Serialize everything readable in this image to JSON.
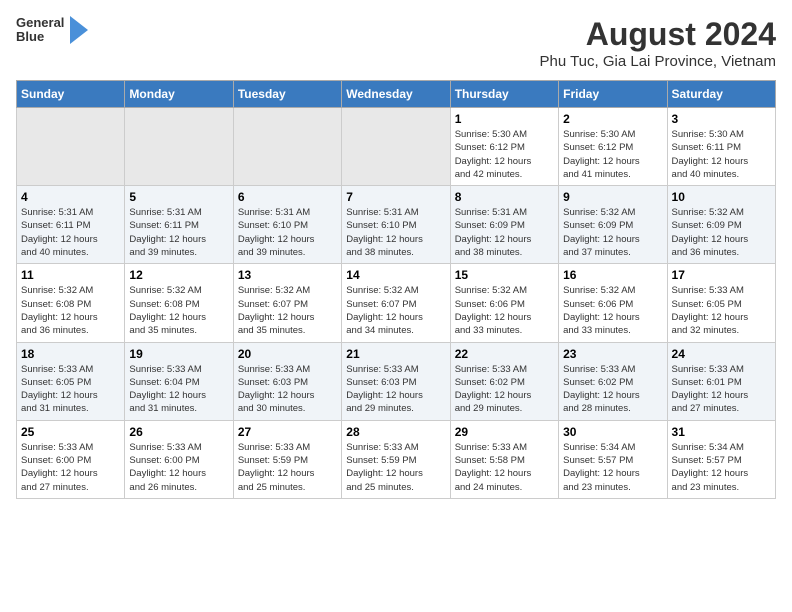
{
  "header": {
    "logo_line1": "General",
    "logo_line2": "Blue",
    "title": "August 2024",
    "subtitle": "Phu Tuc, Gia Lai Province, Vietnam"
  },
  "days_of_week": [
    "Sunday",
    "Monday",
    "Tuesday",
    "Wednesday",
    "Thursday",
    "Friday",
    "Saturday"
  ],
  "weeks": [
    {
      "days": [
        {
          "num": "",
          "info": "",
          "empty": true
        },
        {
          "num": "",
          "info": "",
          "empty": true
        },
        {
          "num": "",
          "info": "",
          "empty": true
        },
        {
          "num": "",
          "info": "",
          "empty": true
        },
        {
          "num": "1",
          "info": "Sunrise: 5:30 AM\nSunset: 6:12 PM\nDaylight: 12 hours\nand 42 minutes.",
          "empty": false
        },
        {
          "num": "2",
          "info": "Sunrise: 5:30 AM\nSunset: 6:12 PM\nDaylight: 12 hours\nand 41 minutes.",
          "empty": false
        },
        {
          "num": "3",
          "info": "Sunrise: 5:30 AM\nSunset: 6:11 PM\nDaylight: 12 hours\nand 40 minutes.",
          "empty": false
        }
      ]
    },
    {
      "days": [
        {
          "num": "4",
          "info": "Sunrise: 5:31 AM\nSunset: 6:11 PM\nDaylight: 12 hours\nand 40 minutes.",
          "empty": false
        },
        {
          "num": "5",
          "info": "Sunrise: 5:31 AM\nSunset: 6:11 PM\nDaylight: 12 hours\nand 39 minutes.",
          "empty": false
        },
        {
          "num": "6",
          "info": "Sunrise: 5:31 AM\nSunset: 6:10 PM\nDaylight: 12 hours\nand 39 minutes.",
          "empty": false
        },
        {
          "num": "7",
          "info": "Sunrise: 5:31 AM\nSunset: 6:10 PM\nDaylight: 12 hours\nand 38 minutes.",
          "empty": false
        },
        {
          "num": "8",
          "info": "Sunrise: 5:31 AM\nSunset: 6:09 PM\nDaylight: 12 hours\nand 38 minutes.",
          "empty": false
        },
        {
          "num": "9",
          "info": "Sunrise: 5:32 AM\nSunset: 6:09 PM\nDaylight: 12 hours\nand 37 minutes.",
          "empty": false
        },
        {
          "num": "10",
          "info": "Sunrise: 5:32 AM\nSunset: 6:09 PM\nDaylight: 12 hours\nand 36 minutes.",
          "empty": false
        }
      ]
    },
    {
      "days": [
        {
          "num": "11",
          "info": "Sunrise: 5:32 AM\nSunset: 6:08 PM\nDaylight: 12 hours\nand 36 minutes.",
          "empty": false
        },
        {
          "num": "12",
          "info": "Sunrise: 5:32 AM\nSunset: 6:08 PM\nDaylight: 12 hours\nand 35 minutes.",
          "empty": false
        },
        {
          "num": "13",
          "info": "Sunrise: 5:32 AM\nSunset: 6:07 PM\nDaylight: 12 hours\nand 35 minutes.",
          "empty": false
        },
        {
          "num": "14",
          "info": "Sunrise: 5:32 AM\nSunset: 6:07 PM\nDaylight: 12 hours\nand 34 minutes.",
          "empty": false
        },
        {
          "num": "15",
          "info": "Sunrise: 5:32 AM\nSunset: 6:06 PM\nDaylight: 12 hours\nand 33 minutes.",
          "empty": false
        },
        {
          "num": "16",
          "info": "Sunrise: 5:32 AM\nSunset: 6:06 PM\nDaylight: 12 hours\nand 33 minutes.",
          "empty": false
        },
        {
          "num": "17",
          "info": "Sunrise: 5:33 AM\nSunset: 6:05 PM\nDaylight: 12 hours\nand 32 minutes.",
          "empty": false
        }
      ]
    },
    {
      "days": [
        {
          "num": "18",
          "info": "Sunrise: 5:33 AM\nSunset: 6:05 PM\nDaylight: 12 hours\nand 31 minutes.",
          "empty": false
        },
        {
          "num": "19",
          "info": "Sunrise: 5:33 AM\nSunset: 6:04 PM\nDaylight: 12 hours\nand 31 minutes.",
          "empty": false
        },
        {
          "num": "20",
          "info": "Sunrise: 5:33 AM\nSunset: 6:03 PM\nDaylight: 12 hours\nand 30 minutes.",
          "empty": false
        },
        {
          "num": "21",
          "info": "Sunrise: 5:33 AM\nSunset: 6:03 PM\nDaylight: 12 hours\nand 29 minutes.",
          "empty": false
        },
        {
          "num": "22",
          "info": "Sunrise: 5:33 AM\nSunset: 6:02 PM\nDaylight: 12 hours\nand 29 minutes.",
          "empty": false
        },
        {
          "num": "23",
          "info": "Sunrise: 5:33 AM\nSunset: 6:02 PM\nDaylight: 12 hours\nand 28 minutes.",
          "empty": false
        },
        {
          "num": "24",
          "info": "Sunrise: 5:33 AM\nSunset: 6:01 PM\nDaylight: 12 hours\nand 27 minutes.",
          "empty": false
        }
      ]
    },
    {
      "days": [
        {
          "num": "25",
          "info": "Sunrise: 5:33 AM\nSunset: 6:00 PM\nDaylight: 12 hours\nand 27 minutes.",
          "empty": false
        },
        {
          "num": "26",
          "info": "Sunrise: 5:33 AM\nSunset: 6:00 PM\nDaylight: 12 hours\nand 26 minutes.",
          "empty": false
        },
        {
          "num": "27",
          "info": "Sunrise: 5:33 AM\nSunset: 5:59 PM\nDaylight: 12 hours\nand 25 minutes.",
          "empty": false
        },
        {
          "num": "28",
          "info": "Sunrise: 5:33 AM\nSunset: 5:59 PM\nDaylight: 12 hours\nand 25 minutes.",
          "empty": false
        },
        {
          "num": "29",
          "info": "Sunrise: 5:33 AM\nSunset: 5:58 PM\nDaylight: 12 hours\nand 24 minutes.",
          "empty": false
        },
        {
          "num": "30",
          "info": "Sunrise: 5:34 AM\nSunset: 5:57 PM\nDaylight: 12 hours\nand 23 minutes.",
          "empty": false
        },
        {
          "num": "31",
          "info": "Sunrise: 5:34 AM\nSunset: 5:57 PM\nDaylight: 12 hours\nand 23 minutes.",
          "empty": false
        }
      ]
    }
  ]
}
